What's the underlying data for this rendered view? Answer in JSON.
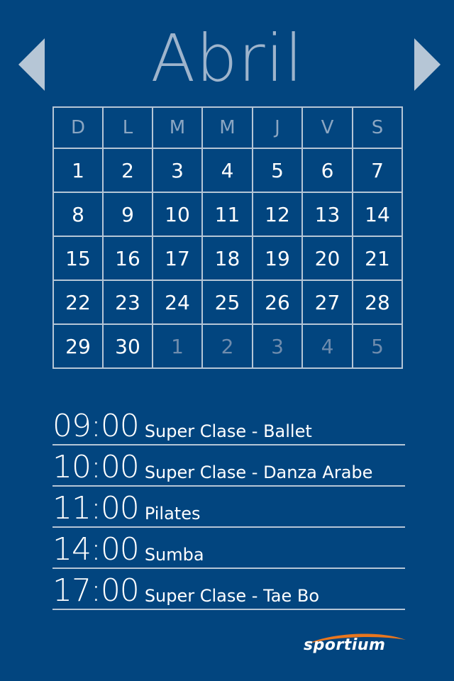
{
  "header": {
    "month": "Abril",
    "prev_label": "Anterior",
    "next_label": "Siguiente"
  },
  "calendar": {
    "weekdays": [
      "D",
      "L",
      "M",
      "M",
      "J",
      "V",
      "S"
    ],
    "weeks": [
      [
        {
          "d": "1"
        },
        {
          "d": "2"
        },
        {
          "d": "3"
        },
        {
          "d": "4"
        },
        {
          "d": "5"
        },
        {
          "d": "6"
        },
        {
          "d": "7"
        }
      ],
      [
        {
          "d": "8"
        },
        {
          "d": "9"
        },
        {
          "d": "10"
        },
        {
          "d": "11"
        },
        {
          "d": "12"
        },
        {
          "d": "13"
        },
        {
          "d": "14"
        }
      ],
      [
        {
          "d": "15"
        },
        {
          "d": "16"
        },
        {
          "d": "17"
        },
        {
          "d": "18"
        },
        {
          "d": "19"
        },
        {
          "d": "20"
        },
        {
          "d": "21"
        }
      ],
      [
        {
          "d": "22"
        },
        {
          "d": "23"
        },
        {
          "d": "24"
        },
        {
          "d": "25"
        },
        {
          "d": "26"
        },
        {
          "d": "27"
        },
        {
          "d": "28"
        }
      ],
      [
        {
          "d": "29"
        },
        {
          "d": "30"
        },
        {
          "d": "1",
          "other": true
        },
        {
          "d": "2",
          "other": true
        },
        {
          "d": "3",
          "other": true
        },
        {
          "d": "4",
          "other": true
        },
        {
          "d": "5",
          "other": true
        }
      ]
    ]
  },
  "schedule": [
    {
      "time": "09:00",
      "title": "Super Clase - Ballet"
    },
    {
      "time": "10:00",
      "title": "Super Clase - Danza Arabe"
    },
    {
      "time": "11:00",
      "title": "Pilates"
    },
    {
      "time": "14:00",
      "title": "Sumba"
    },
    {
      "time": "17:00",
      "title": "Super Clase - Tae Bo"
    }
  ],
  "brand": {
    "name": "sportium",
    "accent": "#e8761e",
    "background": "#02457f"
  }
}
